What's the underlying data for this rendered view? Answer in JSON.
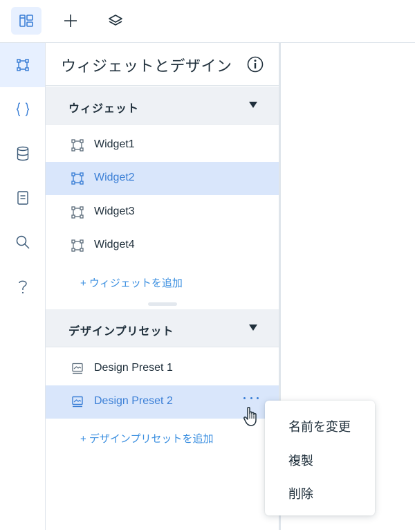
{
  "toolbar": {
    "buttons": [
      {
        "icon": "layout-panels-icon",
        "active": true
      },
      {
        "icon": "plus-icon",
        "active": false
      },
      {
        "icon": "layers-icon",
        "active": false
      }
    ]
  },
  "rail": {
    "items": [
      {
        "icon": "widget-icon",
        "active": true
      },
      {
        "icon": "code-braces-icon",
        "active": false
      },
      {
        "icon": "database-icon",
        "active": false
      },
      {
        "icon": "page-icon",
        "active": false
      },
      {
        "icon": "search-icon",
        "active": false
      },
      {
        "icon": "help-icon",
        "active": false
      }
    ]
  },
  "panel": {
    "title": "ウィジェットとデザイン",
    "info_icon": "info-icon"
  },
  "widgets_section": {
    "title": "ウィジェット",
    "items": [
      {
        "label": "Widget1",
        "selected": false
      },
      {
        "label": "Widget2",
        "selected": true
      },
      {
        "label": "Widget3",
        "selected": false
      },
      {
        "label": "Widget4",
        "selected": false
      }
    ],
    "add_label": "+ ウィジェットを追加"
  },
  "presets_section": {
    "title": "デザインプリセット",
    "items": [
      {
        "label": "Design Preset 1",
        "selected": false
      },
      {
        "label": "Design Preset 2",
        "selected": true
      }
    ],
    "add_label": "+ デザインプリセットを追加"
  },
  "context_menu": {
    "items": [
      "名前を変更",
      "複製",
      "削除"
    ]
  },
  "colors": {
    "accent": "#3b7fd6",
    "link": "#3b8fe0",
    "selected_bg": "#d9e6fb",
    "section_bg": "#eef1f5",
    "text": "#20303c"
  }
}
